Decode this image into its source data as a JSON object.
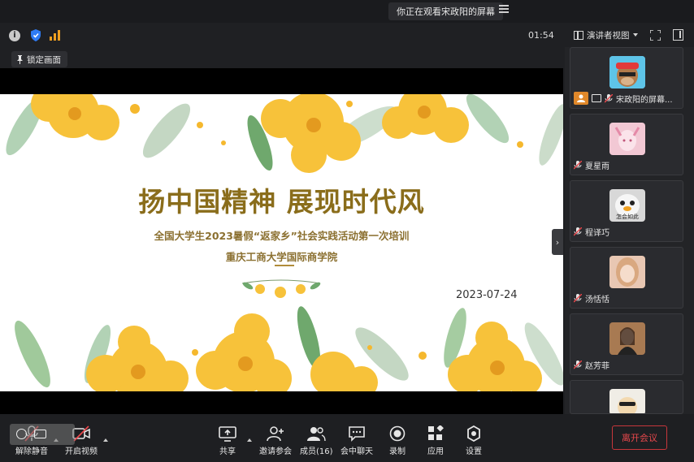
{
  "titlebar": {
    "share_banner": "你正在观看宋政阳的屏幕"
  },
  "toolbar": {
    "timer": "01:54",
    "view_mode": "演讲者视图"
  },
  "lock_button": "锁定画面",
  "slide": {
    "title": "扬中国精神 展现时代风",
    "subtitle": "全国大学生2023暑假“返家乡”社会实践活动第一次培训",
    "organization": "重庆工商大学国际商学院",
    "date": "2023-07-24"
  },
  "participants": [
    {
      "name": "宋政阳的屏幕...",
      "avatar_color": "#5ec4e8"
    },
    {
      "name": "夏星雨",
      "avatar_color": "#f2c8d4"
    },
    {
      "name": "程译巧",
      "avatar_color": "#d8d8d8",
      "avatar_text": "怎会如此"
    },
    {
      "name": "汤恬恬",
      "avatar_color": "#e8c7b3"
    },
    {
      "name": "赵芳菲",
      "avatar_color": "#a87a52"
    }
  ],
  "bottom_toolbar": {
    "unmute": "解除静音",
    "start_video": "开启视频",
    "share": "共享",
    "invite": "邀请参会",
    "members": "成员(16)",
    "chat": "会中聊天",
    "record": "录制",
    "apps": "应用",
    "settings": "设置",
    "leave": "离开会议"
  },
  "colors": {
    "accent_orange": "#e0882a",
    "leave_red": "#e8484c",
    "slide_title": "#8a6d1b",
    "signal": "#f0a020",
    "shield": "#2f7cf6"
  }
}
